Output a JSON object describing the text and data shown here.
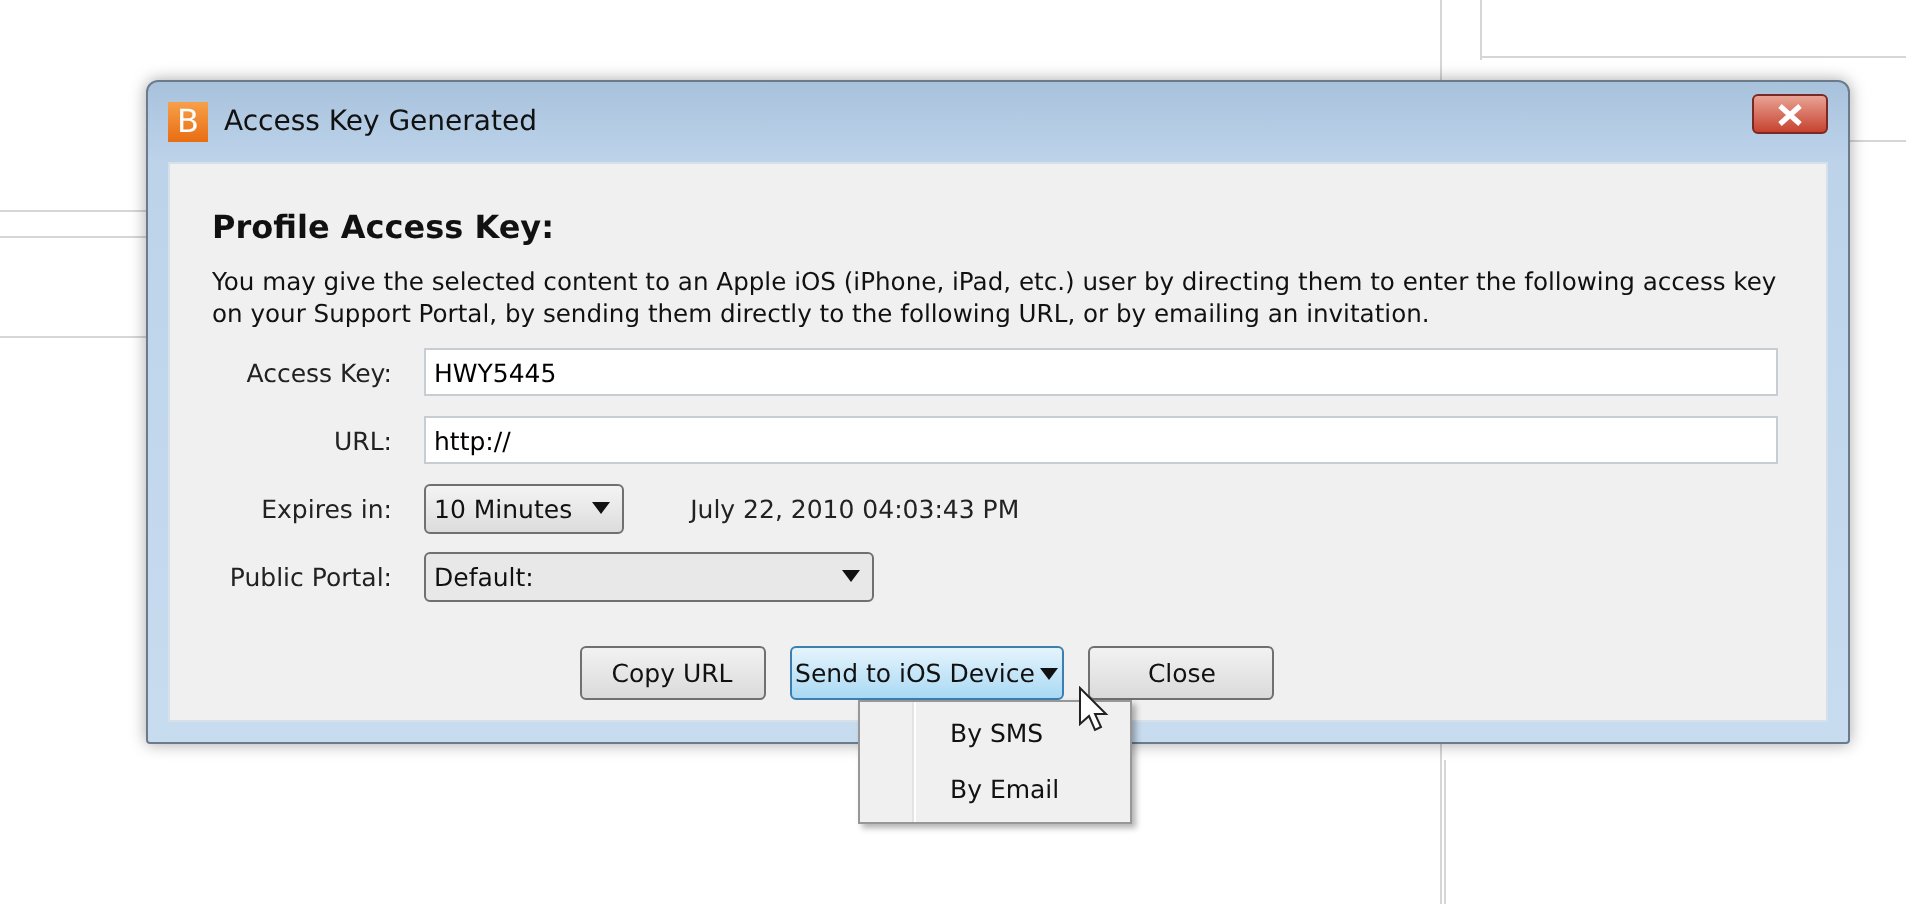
{
  "window": {
    "title": "Access Key Generated",
    "logo": "B"
  },
  "heading": "Profile Access Key:",
  "description": "You may give the selected content to an Apple iOS (iPhone, iPad, etc.) user by directing them to enter the following access key on your Support Portal, by sending them directly to the following URL, or by emailing an invitation.",
  "fields": [
    {
      "kind": "text",
      "label": "Access Key:",
      "value": "HWY5445"
    },
    {
      "kind": "text",
      "label": "URL:",
      "value": "http://"
    },
    {
      "kind": "select",
      "label": "Expires in:",
      "value": "10 Minutes",
      "note": "July 22, 2010 04:03:43 PM"
    },
    {
      "kind": "wideselect",
      "label": "Public Portal:",
      "value": "Default:"
    }
  ],
  "buttons": [
    {
      "label": "Copy URL",
      "menu": false,
      "pressed": false
    },
    {
      "label": "Send to iOS Device",
      "menu": true,
      "pressed": true
    },
    {
      "label": "Close",
      "menu": false,
      "pressed": false
    }
  ],
  "menu": {
    "items": [
      {
        "label": "By SMS"
      },
      {
        "label": "By Email"
      }
    ]
  }
}
